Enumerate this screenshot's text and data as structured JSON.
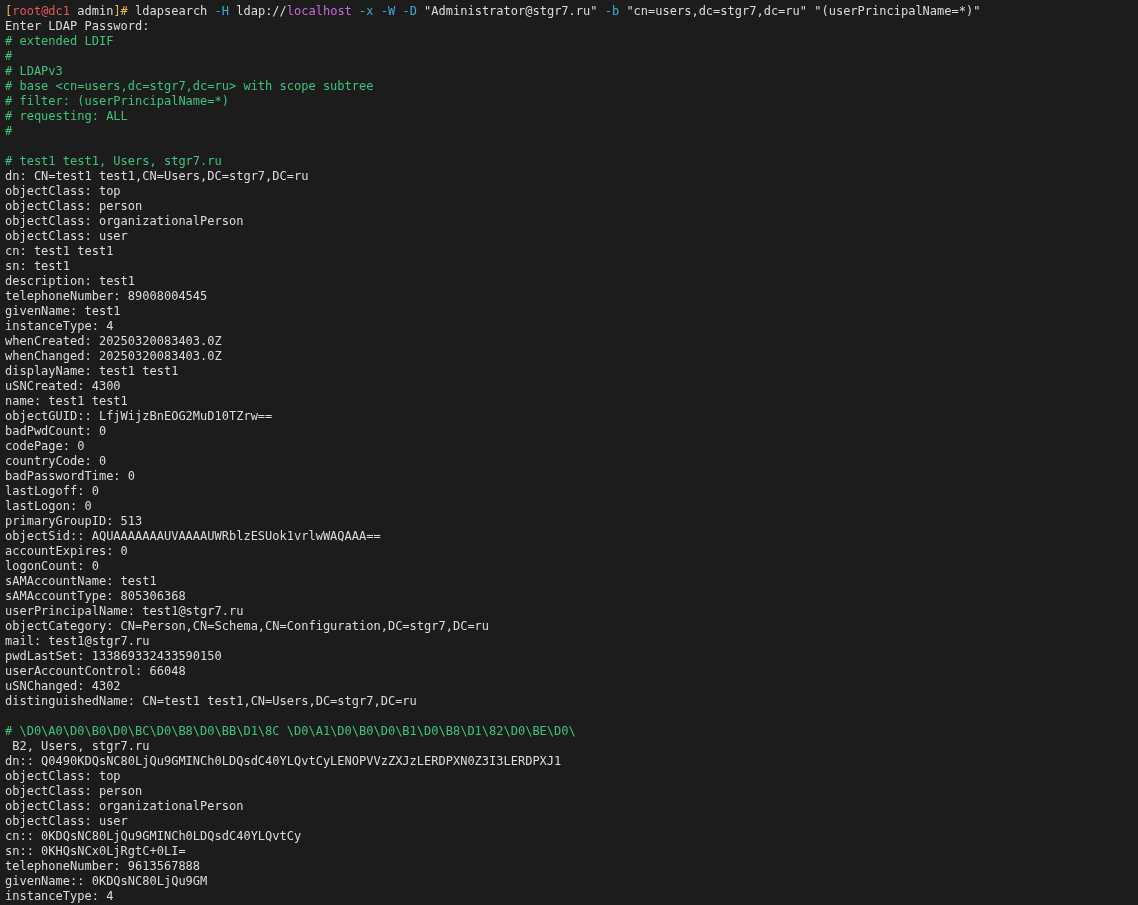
{
  "terminal": {
    "lines": [
      {
        "kind": "prompt",
        "segments": [
          {
            "text": "[",
            "color": "#e5b94a"
          },
          {
            "text": "root@dc1",
            "color": "#e0575b"
          },
          {
            "text": " admin",
            "color": "#dcdcdc"
          },
          {
            "text": "]# ",
            "color": "#e5b94a"
          },
          {
            "text": "ldapsearch ",
            "color": "#dcdcdc"
          },
          {
            "text": "-H",
            "color": "#3fa8d8"
          },
          {
            "text": " ldap://",
            "color": "#dcdcdc"
          },
          {
            "text": "localhost",
            "color": "#c46ae0"
          },
          {
            "text": " -x -W -D",
            "color": "#3fa8d8"
          },
          {
            "text": " \"Administrator@stgr7.ru\" ",
            "color": "#dcdcdc"
          },
          {
            "text": "-b",
            "color": "#3fa8d8"
          },
          {
            "text": " \"cn=users,dc=stgr7,dc=ru\" \"(userPrincipalName=*)\"",
            "color": "#dcdcdc"
          }
        ]
      },
      {
        "kind": "output",
        "text": "Enter LDAP Password:"
      },
      {
        "kind": "comment",
        "text": "# extended LDIF"
      },
      {
        "kind": "comment",
        "text": "#"
      },
      {
        "kind": "comment",
        "text": "# LDAPv3"
      },
      {
        "kind": "comment",
        "text": "# base <cn=users,dc=stgr7,dc=ru> with scope subtree"
      },
      {
        "kind": "comment",
        "text": "# filter: (userPrincipalName=*)"
      },
      {
        "kind": "comment",
        "text": "# requesting: ALL"
      },
      {
        "kind": "comment",
        "text": "#"
      },
      {
        "kind": "blank"
      },
      {
        "kind": "comment",
        "text": "# test1 test1, Users, stgr7.ru"
      },
      {
        "kind": "output",
        "text": "dn: CN=test1 test1,CN=Users,DC=stgr7,DC=ru"
      },
      {
        "kind": "output",
        "text": "objectClass: top"
      },
      {
        "kind": "output",
        "text": "objectClass: person"
      },
      {
        "kind": "output",
        "text": "objectClass: organizationalPerson"
      },
      {
        "kind": "output",
        "text": "objectClass: user"
      },
      {
        "kind": "output",
        "text": "cn: test1 test1"
      },
      {
        "kind": "output",
        "text": "sn: test1"
      },
      {
        "kind": "output",
        "text": "description: test1"
      },
      {
        "kind": "output",
        "text": "telephoneNumber: 89008004545"
      },
      {
        "kind": "output",
        "text": "givenName: test1"
      },
      {
        "kind": "output",
        "text": "instanceType: 4"
      },
      {
        "kind": "output",
        "text": "whenCreated: 20250320083403.0Z"
      },
      {
        "kind": "output",
        "text": "whenChanged: 20250320083403.0Z"
      },
      {
        "kind": "output",
        "text": "displayName: test1 test1"
      },
      {
        "kind": "output",
        "text": "uSNCreated: 4300"
      },
      {
        "kind": "output",
        "text": "name: test1 test1"
      },
      {
        "kind": "output",
        "text": "objectGUID:: LfjWijzBnEOG2MuD10TZrw=="
      },
      {
        "kind": "output",
        "text": "badPwdCount: 0"
      },
      {
        "kind": "output",
        "text": "codePage: 0"
      },
      {
        "kind": "output",
        "text": "countryCode: 0"
      },
      {
        "kind": "output",
        "text": "badPasswordTime: 0"
      },
      {
        "kind": "output",
        "text": "lastLogoff: 0"
      },
      {
        "kind": "output",
        "text": "lastLogon: 0"
      },
      {
        "kind": "output",
        "text": "primaryGroupID: 513"
      },
      {
        "kind": "output",
        "text": "objectSid:: AQUAAAAAAAUVAAAAUWRblzESUok1vrlwWAQAAA=="
      },
      {
        "kind": "output",
        "text": "accountExpires: 0"
      },
      {
        "kind": "output",
        "text": "logonCount: 0"
      },
      {
        "kind": "output",
        "text": "sAMAccountName: test1"
      },
      {
        "kind": "output",
        "text": "sAMAccountType: 805306368"
      },
      {
        "kind": "output",
        "text": "userPrincipalName: test1@stgr7.ru"
      },
      {
        "kind": "output",
        "text": "objectCategory: CN=Person,CN=Schema,CN=Configuration,DC=stgr7,DC=ru"
      },
      {
        "kind": "output",
        "text": "mail: test1@stgr7.ru"
      },
      {
        "kind": "output",
        "text": "pwdLastSet: 133869332433590150"
      },
      {
        "kind": "output",
        "text": "userAccountControl: 66048"
      },
      {
        "kind": "output",
        "text": "uSNChanged: 4302"
      },
      {
        "kind": "output",
        "text": "distinguishedName: CN=test1 test1,CN=Users,DC=stgr7,DC=ru"
      },
      {
        "kind": "blank"
      },
      {
        "kind": "comment",
        "text": "# \\D0\\A0\\D0\\B0\\D0\\BC\\D0\\B8\\D0\\BB\\D1\\8C \\D0\\A1\\D0\\B0\\D0\\B1\\D0\\B8\\D1\\82\\D0\\BE\\D0\\"
      },
      {
        "kind": "output",
        "text": " B2, Users, stgr7.ru"
      },
      {
        "kind": "output",
        "text": "dn:: Q0490KDQsNC80LjQu9GMINCh0LDQsdC40YLQvtCyLENOPVVzZXJzLERDPXN0Z3I3LERDPXJ1"
      },
      {
        "kind": "output",
        "text": "objectClass: top"
      },
      {
        "kind": "output",
        "text": "objectClass: person"
      },
      {
        "kind": "output",
        "text": "objectClass: organizationalPerson"
      },
      {
        "kind": "output",
        "text": "objectClass: user"
      },
      {
        "kind": "output",
        "text": "cn:: 0KDQsNC80LjQu9GMINCh0LDQsdC40YLQvtCy"
      },
      {
        "kind": "output",
        "text": "sn:: 0KHQsNCx0LjRgtC+0LI="
      },
      {
        "kind": "output",
        "text": "telephoneNumber: 9613567888"
      },
      {
        "kind": "output",
        "text": "givenName:: 0KDQsNC80LjQu9GM"
      },
      {
        "kind": "output",
        "text": "instanceType: 4"
      }
    ]
  }
}
